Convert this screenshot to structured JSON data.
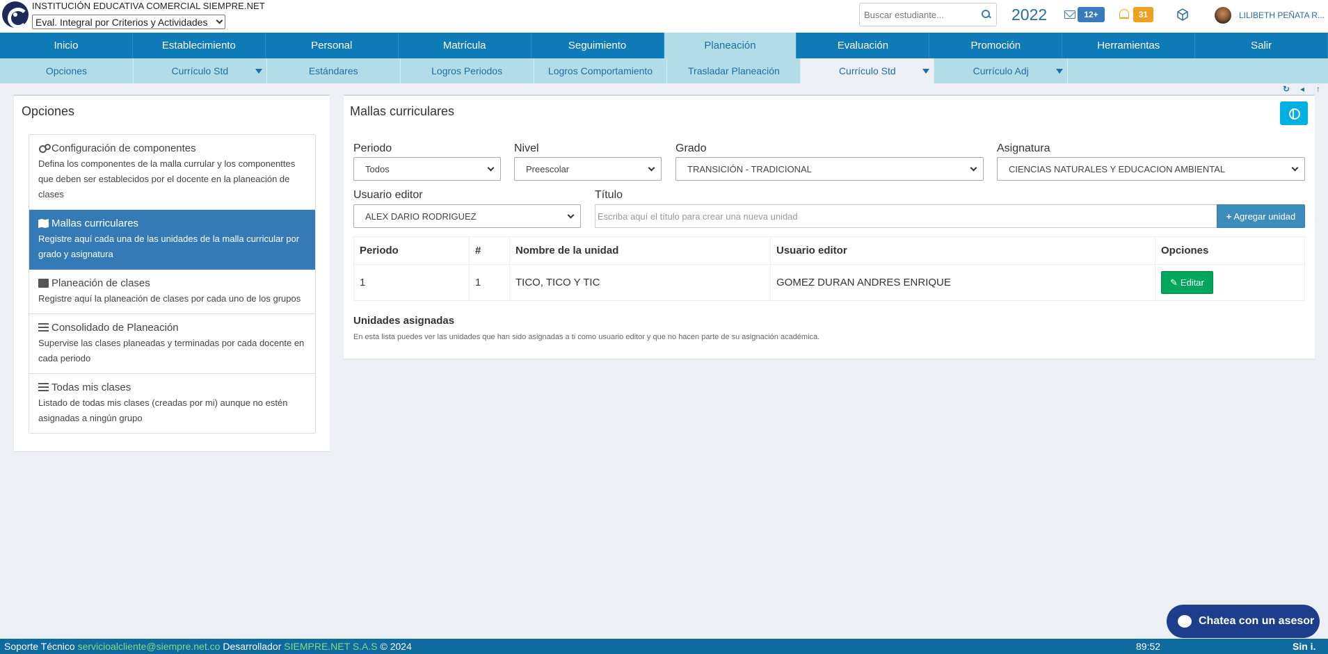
{
  "header": {
    "institution": "INSTITUCIÓN EDUCATIVA COMERCIAL SIEMPRE.NET",
    "eval_selected": "Eval. Integral por Criterios y Actividades",
    "search_placeholder": "Buscar estudiante...",
    "year": "2022",
    "mail_count": "12+",
    "notifications_count": "31",
    "user_name": "LILIBETH PEÑATA R...",
    "colors": {
      "mail_badge": "#3a7bbf",
      "bell_badge": "#f0a020"
    }
  },
  "nav": {
    "items": [
      "Inicio",
      "Establecimiento",
      "Personal",
      "Matrícula",
      "Seguimiento",
      "Planeación",
      "Evaluación",
      "Promoción",
      "Herramientas",
      "Salir"
    ],
    "active": "Planeación"
  },
  "subnav": {
    "items": [
      "Opciones",
      "Currículo Std",
      "Estándares",
      "Logros Periodos",
      "Logros Comportamiento",
      "Trasladar Planeación",
      "Currículo Std",
      "Currículo Adj"
    ],
    "active": "Currículo Std"
  },
  "left_panel": {
    "title": "Opciones",
    "items": [
      {
        "icon": "gears-icon",
        "title": "Configuración de componentes",
        "desc": "Defina los componentes de la malla currular y los componenttes que deben ser establecidos por el docente en la planeación de clases"
      },
      {
        "icon": "map-icon",
        "title": "Mallas curriculares",
        "desc": "Registre aquí cada una de las unidades de la malla curricular por grado y asignatura"
      },
      {
        "icon": "book-icon",
        "title": "Planeación de clases",
        "desc": "Registre aquí la planeación de clases por cada uno de los grupos"
      },
      {
        "icon": "list-icon",
        "title": "Consolidado de Planeación",
        "desc": "Supervise las clases planeadas y terminadas por cada docente en cada periodo"
      },
      {
        "icon": "list-icon",
        "title": "Todas mis clases",
        "desc": "Listado de todas mis clases (creadas por mi) aunque no estén asignadas a ningún grupo"
      }
    ]
  },
  "main": {
    "title": "Mallas curriculares",
    "filters": {
      "periodo_label": "Periodo",
      "periodo_value": "Todos",
      "nivel_label": "Nivel",
      "nivel_value": "Preescolar",
      "grado_label": "Grado",
      "grado_value": "TRANSICIÓN - TRADICIONAL",
      "asignatura_label": "Asignatura",
      "asignatura_value": "CIENCIAS NATURALES Y EDUCACION AMBIENTAL",
      "editor_label": "Usuario editor",
      "editor_value": "ALEX DARIO RODRIGUEZ",
      "titulo_label": "Título",
      "titulo_placeholder": "Escriba aquí el título para crear una nueva unidad"
    },
    "add_button": "Agregar unidad",
    "table": {
      "headers": [
        "Periodo",
        "#",
        "Nombre de la unidad",
        "Usuario editor",
        "Opciones"
      ],
      "rows": [
        {
          "periodo": "1",
          "num": "1",
          "nombre": "TICO, TICO Y TIC",
          "editor": "GOMEZ DURAN ANDRES ENRIQUE",
          "action": "Editar"
        }
      ]
    },
    "assigned_title": "Unidades asignadas",
    "assigned_desc": "En esta lista puedes ver las unidades que han sido asignadas a ti como usuario editor y que no hacen parte de su asignación académica."
  },
  "chat": {
    "label": "Chatea con un asesor"
  },
  "footer": {
    "support_label": "Soporte Técnico",
    "support_email": "servicioalcliente@siempre.net.co",
    "dev_label": "Desarrollador",
    "dev_name": "SIEMPRE.NET S.A.S",
    "copyright": "© 2024",
    "time": "89:52",
    "right_text": "Sin i."
  }
}
